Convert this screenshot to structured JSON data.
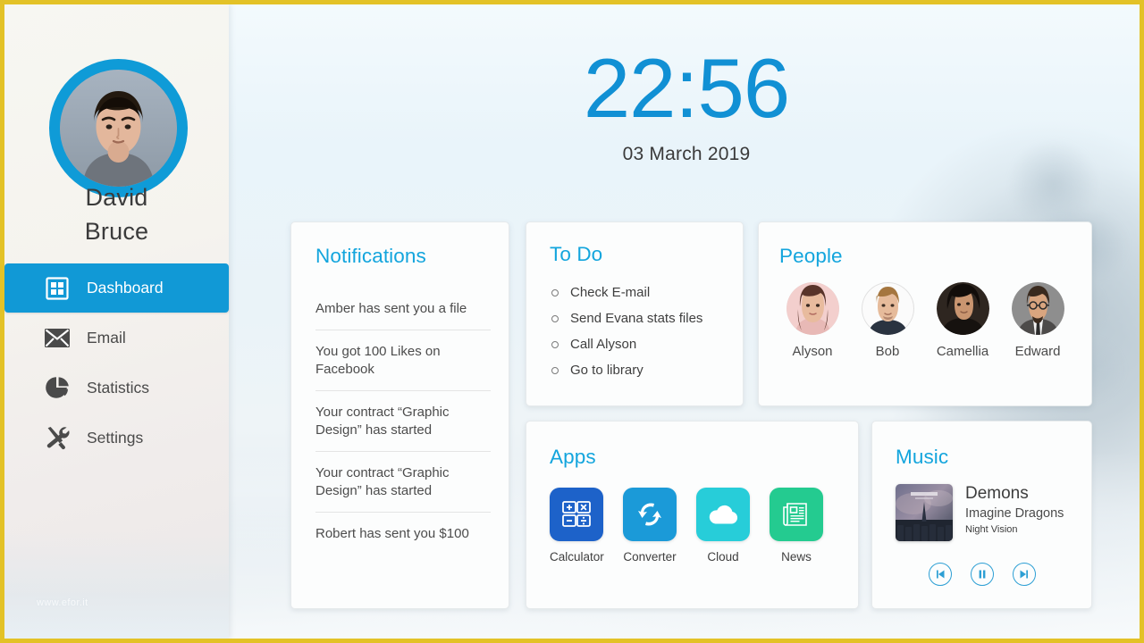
{
  "theme": {
    "accent": "#1190d4",
    "card_title_color": "#13a5dd",
    "frame_border": "#e3c227",
    "sidebar_active_bg": "#1199d6"
  },
  "sidebar": {
    "user": {
      "name_line1": "David",
      "name_line2": "Bruce",
      "avatar_alt": "user-portrait"
    },
    "items": [
      {
        "label": "Dashboard",
        "icon": "grid-icon",
        "active": true
      },
      {
        "label": "Email",
        "icon": "envelope-icon",
        "active": false
      },
      {
        "label": "Statistics",
        "icon": "pie-chart-icon",
        "active": false
      },
      {
        "label": "Settings",
        "icon": "tools-icon",
        "active": false
      }
    ],
    "watermark": "www.efor.it"
  },
  "clock": {
    "time": "22:56",
    "date": "03 March 2019"
  },
  "notifications": {
    "title": "Notifications",
    "items": [
      "Amber has sent you a file",
      "You got 100 Likes on Facebook",
      "Your contract “Graphic Design” has started",
      "Your contract “Graphic Design” has started",
      "Robert has sent you $100"
    ]
  },
  "todo": {
    "title": "To Do",
    "items": [
      "Check E-mail",
      "Send Evana stats files",
      "Call Alyson",
      "Go to library"
    ]
  },
  "people": {
    "title": "People",
    "items": [
      {
        "name": "Alyson",
        "avatar": "woman-portrait-pink"
      },
      {
        "name": "Bob",
        "avatar": "man-portrait-white"
      },
      {
        "name": "Camellia",
        "avatar": "woman-portrait-dark"
      },
      {
        "name": "Edward",
        "avatar": "man-glasses-portrait"
      }
    ]
  },
  "apps": {
    "title": "Apps",
    "items": [
      {
        "name": "Calculator",
        "icon": "calculator-icon",
        "color": "#1d62c9"
      },
      {
        "name": "Converter",
        "icon": "convert-arrows-icon",
        "color": "#1b9ad8"
      },
      {
        "name": "Cloud",
        "icon": "cloud-icon",
        "color": "#27cdd9"
      },
      {
        "name": "News",
        "icon": "newspaper-icon",
        "color": "#24cb90"
      }
    ]
  },
  "music": {
    "title": "Music",
    "track": "Demons",
    "artist": "Imagine Dragons",
    "album": "Night Vision",
    "album_art_alt": "night-visions-album-cover",
    "controls": [
      {
        "name": "previous-track-button",
        "glyph": "previous"
      },
      {
        "name": "pause-button",
        "glyph": "pause"
      },
      {
        "name": "next-track-button",
        "glyph": "next"
      }
    ]
  }
}
